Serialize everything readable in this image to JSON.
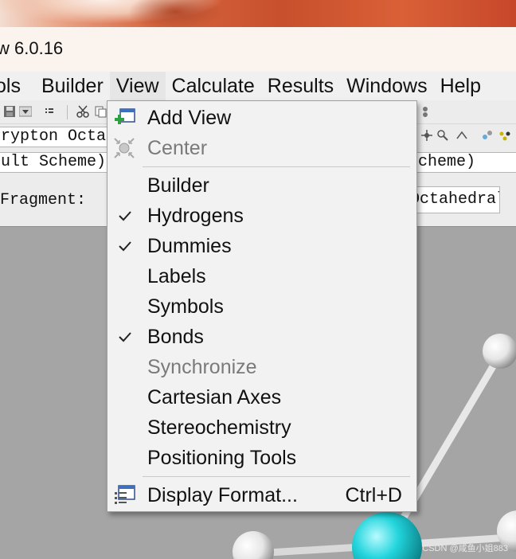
{
  "window": {
    "title": "w 6.0.16"
  },
  "menubar": {
    "items": [
      {
        "label": "ols"
      },
      {
        "label": "Builder"
      },
      {
        "label": "View"
      },
      {
        "label": "Calculate"
      },
      {
        "label": "Results"
      },
      {
        "label": "Windows"
      },
      {
        "label": "Help"
      }
    ]
  },
  "toolbar": {
    "element_field": "rypton Octal",
    "element_field_right": "Octahedral",
    "scheme_field_left": "ult Scheme)",
    "scheme_field_right": "cheme)",
    "fragment_label": "Fragment:",
    "fragment_value": "Octahedral",
    "icons": [
      "save-icon",
      "dropdown-arrow-icon",
      "list-icon",
      "cut-icon",
      "copy-icon"
    ]
  },
  "view_menu": {
    "items": [
      {
        "label": "Add View",
        "icon": "add-view-icon",
        "enabled": true,
        "checked": false
      },
      {
        "label": "Center",
        "icon": "center-icon",
        "enabled": false,
        "checked": false
      },
      {
        "label": "Builder",
        "enabled": true,
        "checked": false
      },
      {
        "label": "Hydrogens",
        "enabled": true,
        "checked": true
      },
      {
        "label": "Dummies",
        "enabled": true,
        "checked": true
      },
      {
        "label": "Labels",
        "enabled": true,
        "checked": false
      },
      {
        "label": "Symbols",
        "enabled": true,
        "checked": false
      },
      {
        "label": "Bonds",
        "enabled": true,
        "checked": true
      },
      {
        "label": "Synchronize",
        "enabled": false,
        "checked": false
      },
      {
        "label": "Cartesian Axes",
        "enabled": true,
        "checked": false
      },
      {
        "label": "Stereochemistry",
        "enabled": true,
        "checked": false
      },
      {
        "label": "Positioning Tools",
        "enabled": true,
        "checked": false
      },
      {
        "label": "Display Format...",
        "icon": "display-format-icon",
        "shortcut": "Ctrl+D",
        "enabled": true,
        "checked": false
      }
    ]
  },
  "viewport": {
    "background": "#a5a5a5",
    "central_atom_color": "#1fd0d8",
    "atom_color": "#f2f2f2"
  },
  "watermark": "CSDN @咸鱼小姐883"
}
